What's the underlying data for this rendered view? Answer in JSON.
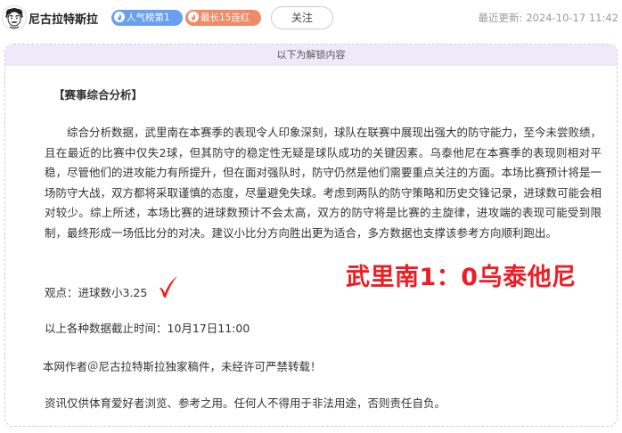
{
  "header": {
    "author_name": "尼古拉特斯拉",
    "badges": [
      {
        "label": "人气榜第1",
        "color": "#6a9ff0"
      },
      {
        "label": "最长15连红",
        "color": "#f08a67"
      }
    ],
    "follow_label": "关注",
    "last_update_label": "最近更新:",
    "last_update_time": "2024-10-17 11:42"
  },
  "unlock_notice": "以下为解锁内容",
  "article": {
    "section_title": "【赛事综合分析】",
    "analysis": "综合分析数据，武里南在本赛季的表现令人印象深刻，球队在联赛中展现出强大的防守能力，至今未尝败绩，且在最近的比赛中仅失2球，但其防守的稳定性无疑是球队成功的关键因素。乌泰他尼在本赛季的表现则相对平稳，尽管他们的进攻能力有所提升，但在面对强队时，防守仍然是他们需要重点关注的方面。本场比赛预计将是一场防守大战，双方都将采取谨慎的态度，尽量避免失球。考虑到两队的防守策略和历史交锋记录，进球数可能会相对较少。综上所述，本场比赛的进球数预计不会太高，双方的防守将是比赛的主旋律，进攻端的表现可能受到限制，最终形成一场低比分的对决。建议小比分方向胜出更为适合，多方数据也支撑该参考方向顺利跑出。",
    "viewpoint": "观点：进球数小3.25",
    "score_prediction": "武里南1：0乌泰他尼",
    "data_cutoff": "以上各种数据截止时间：10月17日11:00",
    "copyright": "本网作者＠尼古拉特斯拉独家稿件，未经许可严禁转载！",
    "disclaimer": "资讯仅供体育爱好者浏览、参考之用。任何人不得用于非法用途，否则责任自负。"
  },
  "icons": {
    "avatar": "einstein-avatar-icon",
    "popularity": "flame-badge-icon",
    "streak": "flame-badge-icon",
    "check": "red-check-icon"
  },
  "colors": {
    "accent_red": "#ee1c24",
    "badge_blue": "#6a9ff0",
    "badge_orange": "#f08a67",
    "panel_border": "#cfc6ea",
    "unlock_bg": "#efeaf9"
  }
}
